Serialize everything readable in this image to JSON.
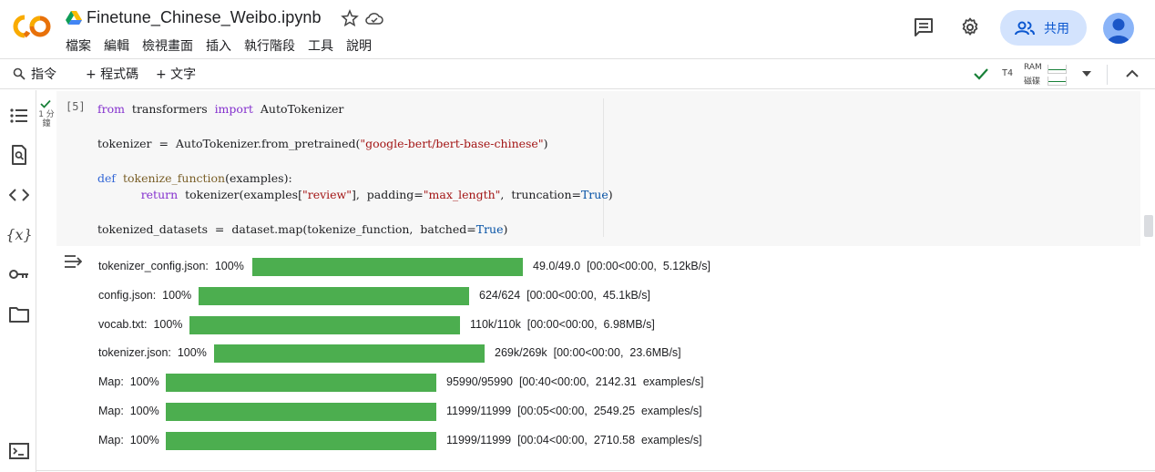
{
  "header": {
    "notebook_title": "Finetune_Chinese_Weibo.ipynb",
    "menu": [
      "檔案",
      "編輯",
      "檢視畫面",
      "插入",
      "執行階段",
      "工具",
      "說明"
    ],
    "share_label": "共用",
    "logo_colors": {
      "primary": "#f9ab00",
      "secondary": "#e8710a"
    }
  },
  "toolbar": {
    "command_label": "指令",
    "add_code_label": "+ 程式碼",
    "add_text_label": "+ 文字",
    "runtime_gpu": "T4",
    "ram_label": "RAM",
    "disk_label": "磁碟"
  },
  "rail": {
    "icons": [
      "toc-icon",
      "find-replace-icon",
      "code-snippets-icon",
      "variables-icon",
      "secrets-key-icon",
      "files-folder-icon",
      "terminal-icon"
    ]
  },
  "cell": {
    "execution_count": "[5]",
    "exec_time_line1": "1 分",
    "exec_time_line2": "鐘",
    "code_lines": [
      "from transformers import AutoTokenizer",
      "",
      "tokenizer = AutoTokenizer.from_pretrained(\"google-bert/bert-base-chinese\")",
      "",
      "def tokenize_function(examples):",
      "    return tokenizer(examples[\"review\"], padding=\"max_length\", truncation=True)",
      "",
      "tokenized_datasets = dataset.map(tokenize_function, batched=True)"
    ]
  },
  "output": {
    "rows": [
      {
        "label": "tokenizer_config.json:  100%",
        "progress": 1.0,
        "stats": "49.0/49.0  [00:00<00:00,  5.12kB/s]"
      },
      {
        "label": "config.json:  100%",
        "progress": 1.0,
        "stats": "624/624  [00:00<00:00,  45.1kB/s]"
      },
      {
        "label": "vocab.txt:  100%",
        "progress": 1.0,
        "stats": "110k/110k  [00:00<00:00,  6.98MB/s]"
      },
      {
        "label": "tokenizer.json:  100%",
        "progress": 1.0,
        "stats": "269k/269k  [00:00<00:00,  23.6MB/s]"
      },
      {
        "label": "Map:  100%",
        "progress": 1.0,
        "stats": "95990/95990  [00:40<00:00,  2142.31  examples/s]"
      },
      {
        "label": "Map:  100%",
        "progress": 1.0,
        "stats": "11999/11999  [00:05<00:00,  2549.25  examples/s]"
      },
      {
        "label": "Map:  100%",
        "progress": 1.0,
        "stats": "11999/11999  [00:04<00:00,  2710.58  examples/s]"
      }
    ],
    "bar_color": "#4cae4f"
  }
}
